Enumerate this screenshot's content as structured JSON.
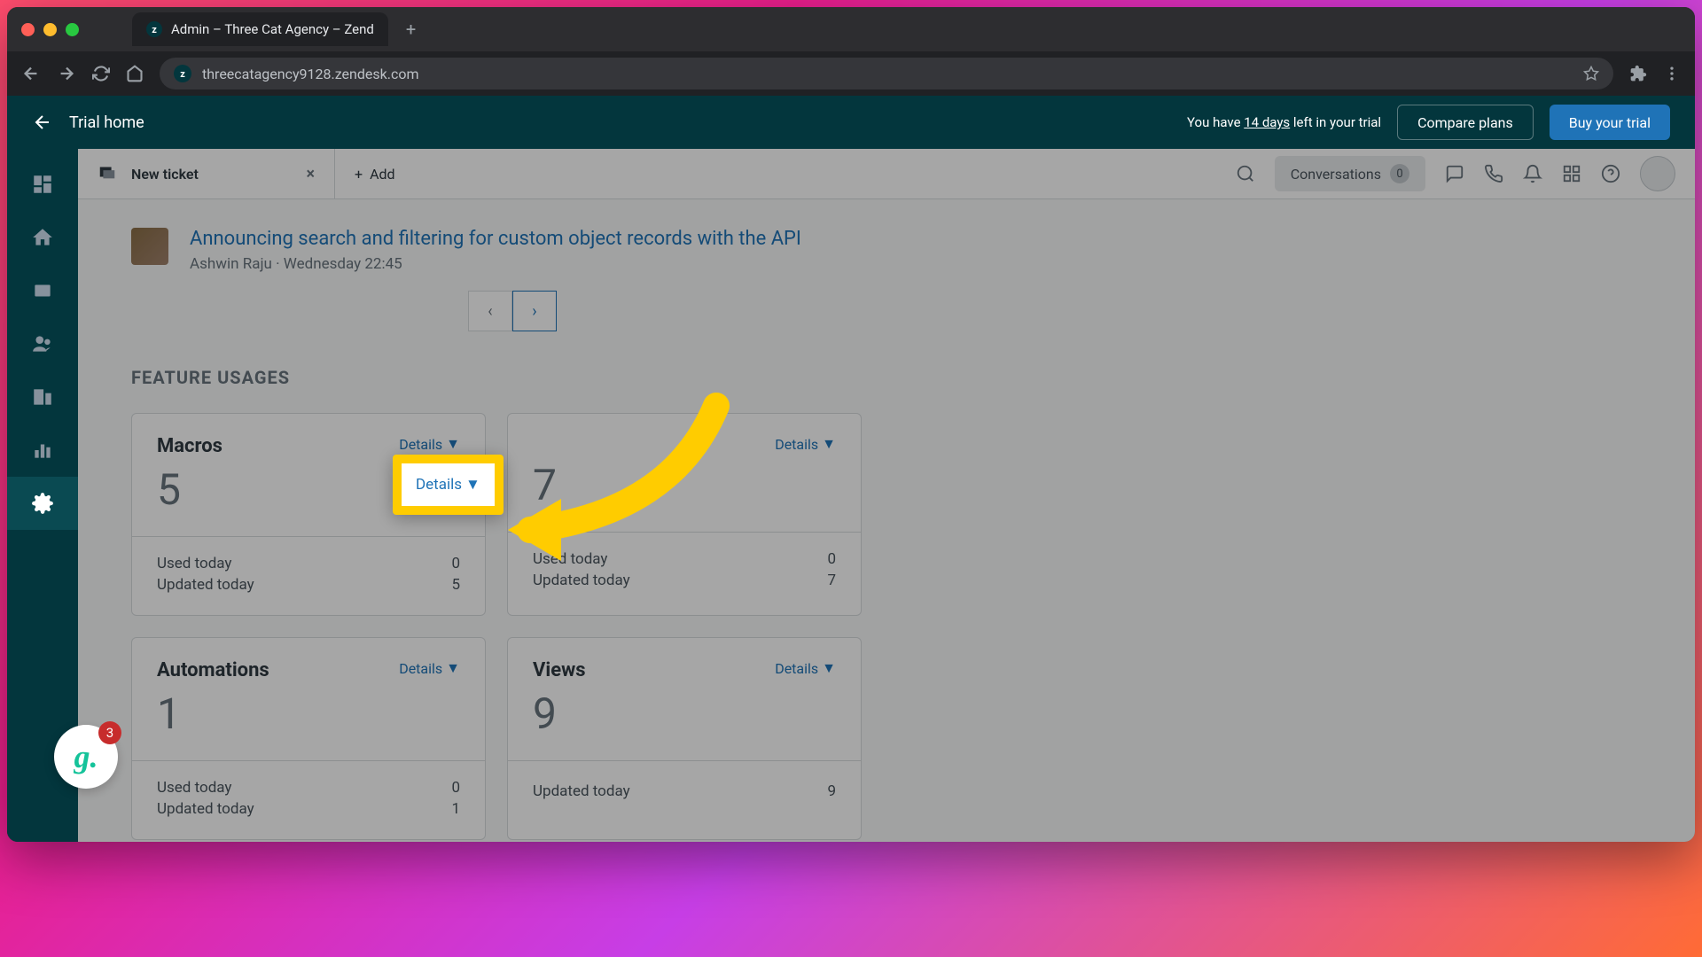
{
  "browser": {
    "tab_title": "Admin – Three Cat Agency – Zend",
    "url": "threecatagency9128.zendesk.com"
  },
  "trial_bar": {
    "back_label": "Trial home",
    "message_prefix": "You have ",
    "days": "14 days",
    "message_suffix": " left in your trial",
    "compare_label": "Compare plans",
    "buy_label": "Buy your trial"
  },
  "tabs": {
    "new_ticket": "New ticket",
    "add_label": "Add"
  },
  "topbar": {
    "conversations_label": "Conversations",
    "conversations_count": "0"
  },
  "announcement": {
    "title": "Announcing search and filtering for custom object records with the API",
    "author": "Ashwin Raju",
    "separator": " · ",
    "timestamp": "Wednesday 22:45"
  },
  "pager": {
    "prev": "‹",
    "next": "›"
  },
  "section_title": "FEATURE USAGES",
  "details_label": "Details",
  "details_arrow": "▼",
  "cards": [
    {
      "title": "Macros",
      "count": "5",
      "stats": [
        {
          "label": "Used today",
          "value": "0"
        },
        {
          "label": "Updated today",
          "value": "5"
        }
      ]
    },
    {
      "title": "",
      "count": "7",
      "stats": [
        {
          "label": "Used today",
          "value": "0"
        },
        {
          "label": "Updated today",
          "value": "7"
        }
      ]
    },
    {
      "title": "Automations",
      "count": "1",
      "stats": [
        {
          "label": "Used today",
          "value": "0"
        },
        {
          "label": "Updated today",
          "value": "1"
        }
      ]
    },
    {
      "title": "Views",
      "count": "9",
      "stats": [
        {
          "label": "Updated today",
          "value": "9"
        }
      ]
    }
  ],
  "grammarly_badge": "3"
}
